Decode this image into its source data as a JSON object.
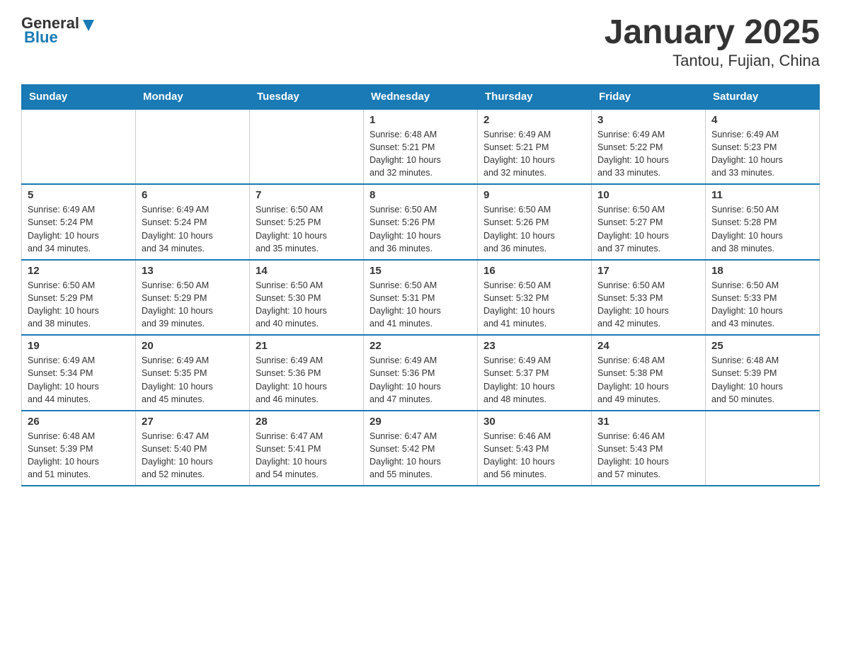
{
  "header": {
    "logo": {
      "general": "General",
      "blue": "Blue"
    },
    "title": "January 2025",
    "subtitle": "Tantou, Fujian, China"
  },
  "days_of_week": [
    "Sunday",
    "Monday",
    "Tuesday",
    "Wednesday",
    "Thursday",
    "Friday",
    "Saturday"
  ],
  "weeks": [
    [
      {
        "day": "",
        "info": ""
      },
      {
        "day": "",
        "info": ""
      },
      {
        "day": "",
        "info": ""
      },
      {
        "day": "1",
        "info": "Sunrise: 6:48 AM\nSunset: 5:21 PM\nDaylight: 10 hours\nand 32 minutes."
      },
      {
        "day": "2",
        "info": "Sunrise: 6:49 AM\nSunset: 5:21 PM\nDaylight: 10 hours\nand 32 minutes."
      },
      {
        "day": "3",
        "info": "Sunrise: 6:49 AM\nSunset: 5:22 PM\nDaylight: 10 hours\nand 33 minutes."
      },
      {
        "day": "4",
        "info": "Sunrise: 6:49 AM\nSunset: 5:23 PM\nDaylight: 10 hours\nand 33 minutes."
      }
    ],
    [
      {
        "day": "5",
        "info": "Sunrise: 6:49 AM\nSunset: 5:24 PM\nDaylight: 10 hours\nand 34 minutes."
      },
      {
        "day": "6",
        "info": "Sunrise: 6:49 AM\nSunset: 5:24 PM\nDaylight: 10 hours\nand 34 minutes."
      },
      {
        "day": "7",
        "info": "Sunrise: 6:50 AM\nSunset: 5:25 PM\nDaylight: 10 hours\nand 35 minutes."
      },
      {
        "day": "8",
        "info": "Sunrise: 6:50 AM\nSunset: 5:26 PM\nDaylight: 10 hours\nand 36 minutes."
      },
      {
        "day": "9",
        "info": "Sunrise: 6:50 AM\nSunset: 5:26 PM\nDaylight: 10 hours\nand 36 minutes."
      },
      {
        "day": "10",
        "info": "Sunrise: 6:50 AM\nSunset: 5:27 PM\nDaylight: 10 hours\nand 37 minutes."
      },
      {
        "day": "11",
        "info": "Sunrise: 6:50 AM\nSunset: 5:28 PM\nDaylight: 10 hours\nand 38 minutes."
      }
    ],
    [
      {
        "day": "12",
        "info": "Sunrise: 6:50 AM\nSunset: 5:29 PM\nDaylight: 10 hours\nand 38 minutes."
      },
      {
        "day": "13",
        "info": "Sunrise: 6:50 AM\nSunset: 5:29 PM\nDaylight: 10 hours\nand 39 minutes."
      },
      {
        "day": "14",
        "info": "Sunrise: 6:50 AM\nSunset: 5:30 PM\nDaylight: 10 hours\nand 40 minutes."
      },
      {
        "day": "15",
        "info": "Sunrise: 6:50 AM\nSunset: 5:31 PM\nDaylight: 10 hours\nand 41 minutes."
      },
      {
        "day": "16",
        "info": "Sunrise: 6:50 AM\nSunset: 5:32 PM\nDaylight: 10 hours\nand 41 minutes."
      },
      {
        "day": "17",
        "info": "Sunrise: 6:50 AM\nSunset: 5:33 PM\nDaylight: 10 hours\nand 42 minutes."
      },
      {
        "day": "18",
        "info": "Sunrise: 6:50 AM\nSunset: 5:33 PM\nDaylight: 10 hours\nand 43 minutes."
      }
    ],
    [
      {
        "day": "19",
        "info": "Sunrise: 6:49 AM\nSunset: 5:34 PM\nDaylight: 10 hours\nand 44 minutes."
      },
      {
        "day": "20",
        "info": "Sunrise: 6:49 AM\nSunset: 5:35 PM\nDaylight: 10 hours\nand 45 minutes."
      },
      {
        "day": "21",
        "info": "Sunrise: 6:49 AM\nSunset: 5:36 PM\nDaylight: 10 hours\nand 46 minutes."
      },
      {
        "day": "22",
        "info": "Sunrise: 6:49 AM\nSunset: 5:36 PM\nDaylight: 10 hours\nand 47 minutes."
      },
      {
        "day": "23",
        "info": "Sunrise: 6:49 AM\nSunset: 5:37 PM\nDaylight: 10 hours\nand 48 minutes."
      },
      {
        "day": "24",
        "info": "Sunrise: 6:48 AM\nSunset: 5:38 PM\nDaylight: 10 hours\nand 49 minutes."
      },
      {
        "day": "25",
        "info": "Sunrise: 6:48 AM\nSunset: 5:39 PM\nDaylight: 10 hours\nand 50 minutes."
      }
    ],
    [
      {
        "day": "26",
        "info": "Sunrise: 6:48 AM\nSunset: 5:39 PM\nDaylight: 10 hours\nand 51 minutes."
      },
      {
        "day": "27",
        "info": "Sunrise: 6:47 AM\nSunset: 5:40 PM\nDaylight: 10 hours\nand 52 minutes."
      },
      {
        "day": "28",
        "info": "Sunrise: 6:47 AM\nSunset: 5:41 PM\nDaylight: 10 hours\nand 54 minutes."
      },
      {
        "day": "29",
        "info": "Sunrise: 6:47 AM\nSunset: 5:42 PM\nDaylight: 10 hours\nand 55 minutes."
      },
      {
        "day": "30",
        "info": "Sunrise: 6:46 AM\nSunset: 5:43 PM\nDaylight: 10 hours\nand 56 minutes."
      },
      {
        "day": "31",
        "info": "Sunrise: 6:46 AM\nSunset: 5:43 PM\nDaylight: 10 hours\nand 57 minutes."
      },
      {
        "day": "",
        "info": ""
      }
    ]
  ]
}
